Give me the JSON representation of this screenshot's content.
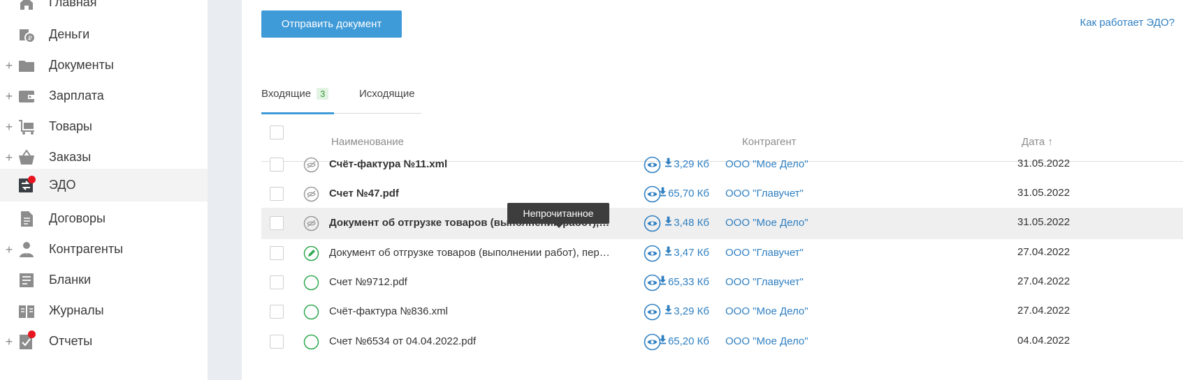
{
  "sidebar": {
    "items": [
      {
        "label": "Главная",
        "plus": "",
        "icon": "home-icon"
      },
      {
        "label": "Деньги",
        "plus": "",
        "icon": "money-icon"
      },
      {
        "label": "Документы",
        "plus": "+",
        "icon": "folder-icon"
      },
      {
        "label": "Зарплата",
        "plus": "+",
        "icon": "wallet-icon"
      },
      {
        "label": "Товары",
        "plus": "+",
        "icon": "cart-icon"
      },
      {
        "label": "Заказы",
        "plus": "+",
        "icon": "basket-icon"
      },
      {
        "label": "ЭДО",
        "plus": "",
        "icon": "edo-exchange-icon"
      },
      {
        "label": "Договоры",
        "plus": "",
        "icon": "contract-icon"
      },
      {
        "label": "Контрагенты",
        "plus": "+",
        "icon": "person-icon"
      },
      {
        "label": "Бланки",
        "plus": "",
        "icon": "forms-icon"
      },
      {
        "label": "Журналы",
        "plus": "",
        "icon": "journal-icon"
      },
      {
        "label": "Отчеты",
        "plus": "+",
        "icon": "report-icon"
      }
    ]
  },
  "toolbar": {
    "send_label": "Отправить документ",
    "how_link": "Как работает ЭДО?"
  },
  "tabs": {
    "incoming": "Входящие",
    "incoming_count": "3",
    "outgoing": "Исходящие"
  },
  "table": {
    "headers": {
      "name": "Наименование",
      "contractor": "Контрагент",
      "date": "Дата ↑"
    },
    "rows": [
      {
        "name": "Счёт-фактура №11.xml",
        "size": "3,29 Кб",
        "contractor": "ООО \"Мое Дело\"",
        "date": "31.05.2022",
        "status": "unread"
      },
      {
        "name": "Счет №47.pdf",
        "size": "65,70 Кб",
        "contractor": "ООО \"Главучет\"",
        "date": "31.05.2022",
        "status": "unread"
      },
      {
        "name": "Документ об отгрузке товаров (выполнении работ), передаче имущественных прав",
        "size": "3,48 Кб",
        "contractor": "ООО \"Мое Дело\"",
        "date": "31.05.2022",
        "status": "unread"
      },
      {
        "name": "Документ об отгрузке товаров (выполнении работ), передаче имущественных прав",
        "size": "3,47 Кб",
        "contractor": "ООО \"Главучет\"",
        "date": "27.04.2022",
        "status": "signed"
      },
      {
        "name": "Счет №9712.pdf",
        "size": "65,33 Кб",
        "contractor": "ООО \"Главучет\"",
        "date": "27.04.2022",
        "status": "read"
      },
      {
        "name": "Счёт-фактура №836.xml",
        "size": "3,29 Кб",
        "contractor": "ООО \"Мое Дело\"",
        "date": "27.04.2022",
        "status": "read"
      },
      {
        "name": "Счет №6534 от 04.04.2022.pdf",
        "size": "65,20 Кб",
        "contractor": "ООО \"Мое Дело\"",
        "date": "04.04.2022",
        "status": "read"
      }
    ]
  },
  "tooltip": {
    "text": "Непрочитанное"
  },
  "colors": {
    "accent": "#3f9ad8",
    "link": "#2f7fc1",
    "alert": "#e8141e",
    "success": "#2fa84f"
  }
}
